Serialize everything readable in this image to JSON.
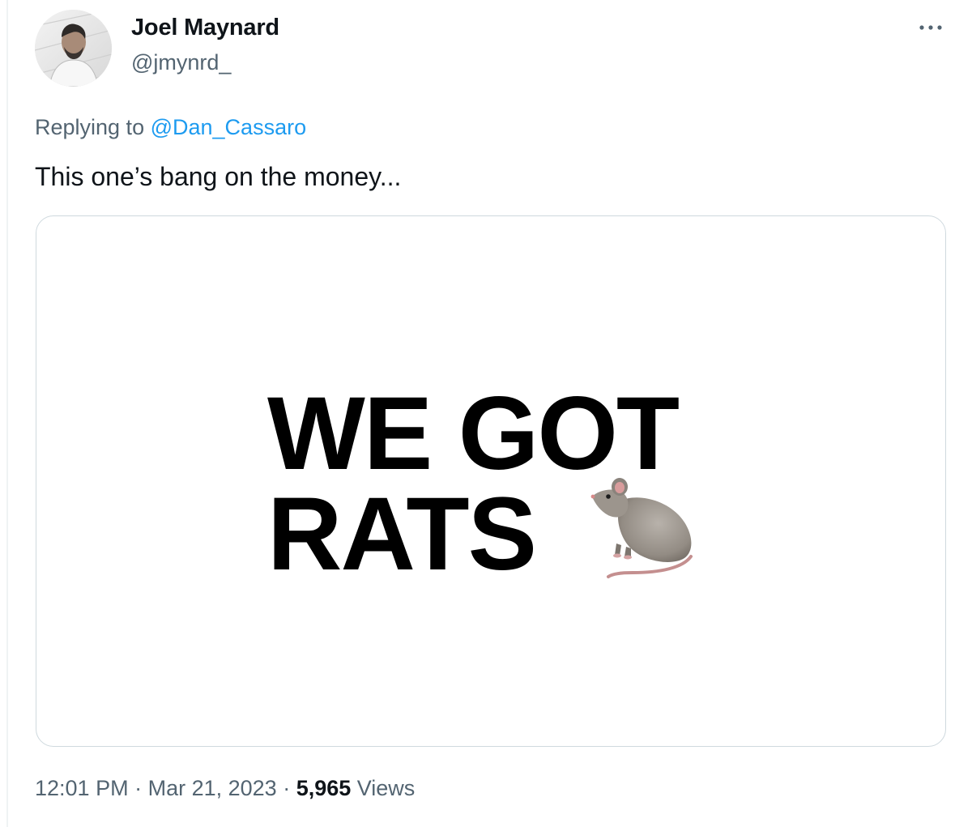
{
  "author": {
    "display_name": "Joel Maynard",
    "handle": "@jmynrd_"
  },
  "more_icon": "more-horizontal-icon",
  "reply": {
    "prefix": "Replying to ",
    "mention": "@Dan_Cassaro"
  },
  "tweet": {
    "text": "This one’s bang on the money..."
  },
  "media": {
    "line1": "WE GOT",
    "line2": "RATS",
    "emoji": "rat-emoji"
  },
  "meta": {
    "time": "12:01 PM",
    "separator": " · ",
    "date": "Mar 21, 2023",
    "views_count": "5,965",
    "views_label": " Views"
  },
  "colors": {
    "text": "#0f1419",
    "secondary": "#536471",
    "link": "#1d9bf0",
    "border": "#cfd9de"
  }
}
